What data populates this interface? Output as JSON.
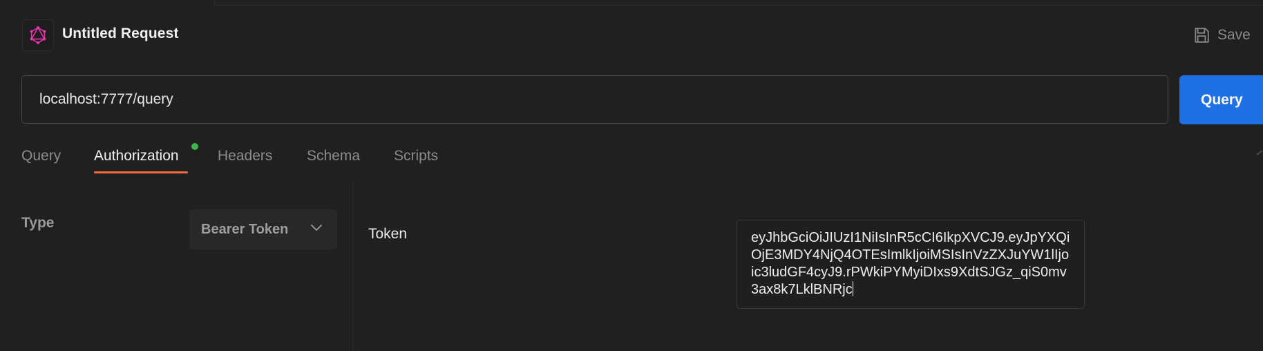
{
  "header": {
    "title": "Untitled Request",
    "save_label": "Save",
    "logo_icon": "graphql-icon",
    "logo_color": "#e535ab"
  },
  "request": {
    "url": "localhost:7777/query",
    "submit_label": "Query",
    "submit_color": "#1f6fe5"
  },
  "tabs": [
    {
      "label": "Query"
    },
    {
      "label": "Authorization",
      "active": true,
      "indicator_color": "#3ab54a"
    },
    {
      "label": "Headers"
    },
    {
      "label": "Schema"
    },
    {
      "label": "Scripts"
    }
  ],
  "accent": "#f26b3a",
  "auth": {
    "type_label": "Type",
    "type_value": "Bearer Token",
    "token_label": "Token",
    "token_value": "eyJhbGciOiJIUzI1NiIsInR5cCI6IkpXVCJ9.eyJpYXQiOjE3MDY4NjQ4OTEsImlkIjoiMSIsInVzZXJuYW1lIjoic3ludGF4cyJ9.rPWkiPYMyiDIxs9XdtSJGz_qiS0mv3ax8k7LklBNRjc"
  }
}
